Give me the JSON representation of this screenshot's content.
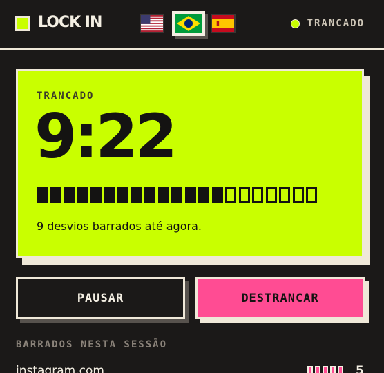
{
  "header": {
    "app_name": "LOCK IN",
    "languages": [
      {
        "name": "English",
        "icon": "us-flag-icon",
        "selected": false
      },
      {
        "name": "Português",
        "icon": "brazil-flag-icon",
        "selected": true
      },
      {
        "name": "Español",
        "icon": "spain-flag-icon",
        "selected": false
      }
    ],
    "status_label": "TRANCADO"
  },
  "lock_card": {
    "label": "TRANCADO",
    "timer": "9:22",
    "progress": {
      "filled": 14,
      "total": 21
    },
    "note": "9 desvios barrados até agora."
  },
  "buttons": {
    "pause_label": "PAUSAR",
    "unlock_label": "DESTRANCAR"
  },
  "blocked": {
    "title": "BARRADOS NESTA SESSÃO",
    "items": [
      {
        "domain": "instagram.com",
        "count": "5"
      }
    ]
  },
  "colors": {
    "accent_lime": "#c9ff00",
    "accent_pink": "#ff4c93",
    "background": "#1b1918",
    "cream": "#efe8d8"
  }
}
